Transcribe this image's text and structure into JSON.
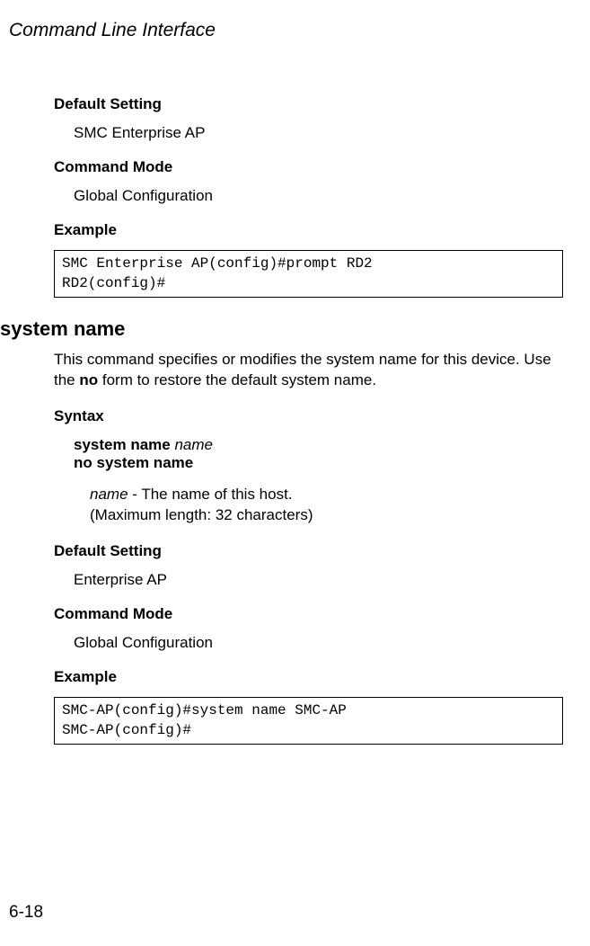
{
  "pageHeader": "Command Line Interface",
  "section1": {
    "headingDefault": "Default Setting",
    "defaultValue": "SMC Enterprise AP",
    "headingMode": "Command Mode",
    "modeValue": "Global Configuration",
    "headingExample": "Example",
    "codeLine1": "SMC Enterprise AP(config)#prompt RD2",
    "codeLine2": "RD2(config)#"
  },
  "commandTitle": "system name",
  "descPart1": "This command specifies or modifies the system name for this device. Use the ",
  "descBold": "no",
  "descPart2": " form to restore the default system name.",
  "syntax": {
    "heading": "Syntax",
    "line1Bold": "system name ",
    "line1Param": "name",
    "line2Bold": "no system name",
    "paramName": "name",
    "paramDesc1": " - The name of this host.",
    "paramDesc2": "(Maximum length: 32 characters)"
  },
  "section2": {
    "headingDefault": "Default Setting",
    "defaultValue": "Enterprise AP",
    "headingMode": "Command Mode",
    "modeValue": "Global Configuration",
    "headingExample": "Example",
    "codeLine1": "SMC-AP(config)#system name SMC-AP",
    "codeLine2": "SMC-AP(config)#"
  },
  "pageNumber": "6-18"
}
